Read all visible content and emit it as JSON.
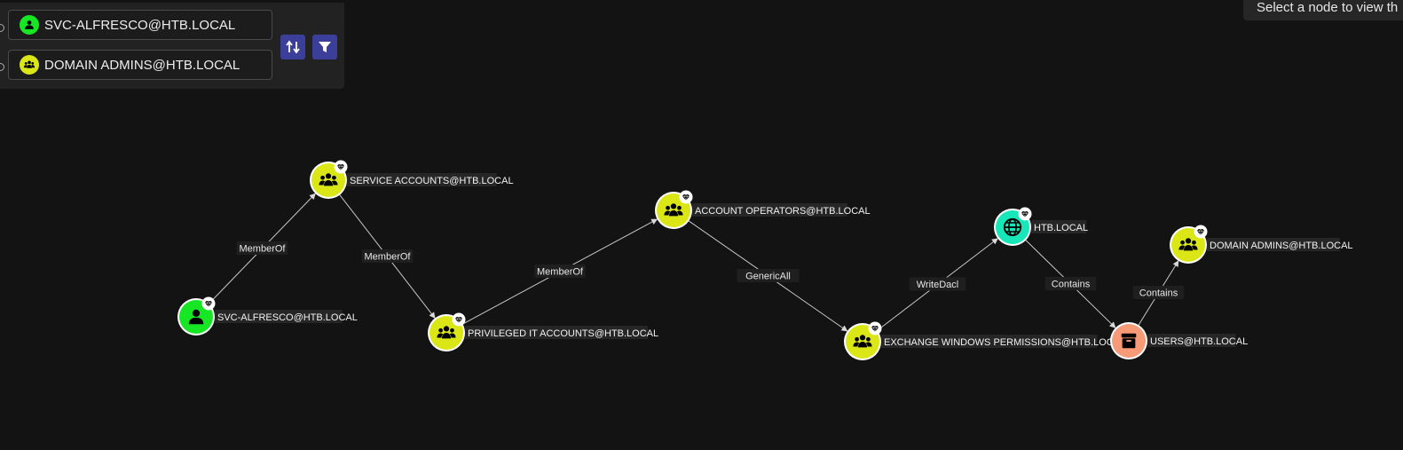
{
  "search": {
    "source": {
      "value": "SVC-ALFRESCO@HTB.LOCAL",
      "icon": "user-icon",
      "color": "#17e625"
    },
    "target": {
      "value": "DOMAIN ADMINS@HTB.LOCAL",
      "icon": "group-icon",
      "color": "#dbe617"
    },
    "swap_icon": "swap-icon",
    "filter_icon": "filter-icon"
  },
  "info_panel": {
    "text": "Select a node to view th"
  },
  "graph": {
    "nodes": [
      {
        "id": "svc",
        "label": "SVC-ALFRESCO@HTB.LOCAL",
        "type": "user",
        "color": "#17e625",
        "icon": "user-icon"
      },
      {
        "id": "sa",
        "label": "SERVICE ACCOUNTS@HTB.LOCAL",
        "type": "group",
        "color": "#dbe617",
        "icon": "group-icon"
      },
      {
        "id": "pit",
        "label": "PRIVILEGED IT ACCOUNTS@HTB.LOCAL",
        "type": "group",
        "color": "#dbe617",
        "icon": "group-icon"
      },
      {
        "id": "ao",
        "label": "ACCOUNT OPERATORS@HTB.LOCAL",
        "type": "group",
        "color": "#dbe617",
        "icon": "group-icon"
      },
      {
        "id": "ewp",
        "label": "EXCHANGE WINDOWS PERMISSIONS@HTB.LOCAL",
        "type": "group",
        "color": "#dbe617",
        "icon": "group-icon"
      },
      {
        "id": "htb",
        "label": "HTB.LOCAL",
        "type": "domain",
        "color": "#17e6b9",
        "icon": "globe-icon"
      },
      {
        "id": "users",
        "label": "USERS@HTB.LOCAL",
        "type": "container",
        "color": "#f79a78",
        "icon": "box-icon"
      },
      {
        "id": "da",
        "label": "DOMAIN ADMINS@HTB.LOCAL",
        "type": "group",
        "color": "#dbe617",
        "icon": "group-icon"
      }
    ],
    "edges": [
      {
        "from": "svc",
        "to": "sa",
        "label": "MemberOf"
      },
      {
        "from": "sa",
        "to": "pit",
        "label": "MemberOf"
      },
      {
        "from": "pit",
        "to": "ao",
        "label": "MemberOf"
      },
      {
        "from": "ao",
        "to": "ewp",
        "label": "GenericAll"
      },
      {
        "from": "ewp",
        "to": "htb",
        "label": "WriteDacl"
      },
      {
        "from": "htb",
        "to": "users",
        "label": "Contains"
      },
      {
        "from": "users",
        "to": "da",
        "label": "Contains"
      }
    ]
  }
}
